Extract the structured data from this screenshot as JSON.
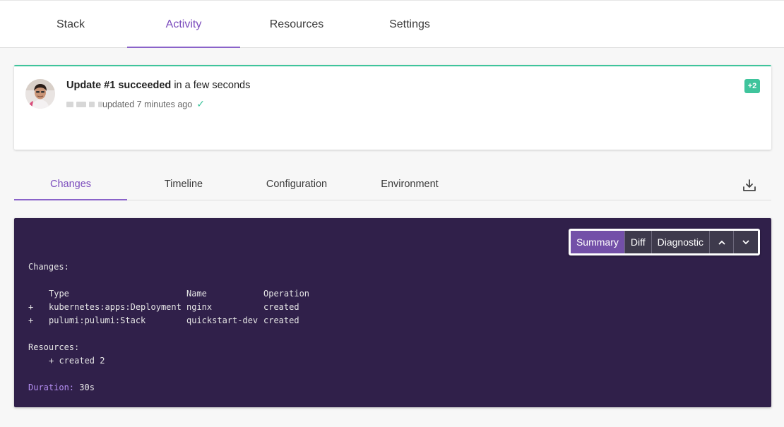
{
  "top_tabs": [
    "Stack",
    "Activity",
    "Resources",
    "Settings"
  ],
  "update": {
    "title_bold": "Update #1 succeeded",
    "title_rest": " in a few seconds",
    "sub": "updated 7 minutes ago",
    "badge": "+2"
  },
  "sub_tabs": [
    "Changes",
    "Timeline",
    "Configuration",
    "Environment"
  ],
  "toolbar": {
    "summary": "Summary",
    "diff": "Diff",
    "diagnostic": "Diagnostic",
    "up": "⌃",
    "down": "⌄"
  },
  "output": {
    "changes_label": "Changes:",
    "header": {
      "type": "Type",
      "name": "Name",
      "op": "Operation"
    },
    "rows": [
      {
        "sign": "+",
        "type": "kubernetes:apps:Deployment",
        "name": "nginx",
        "op": "created"
      },
      {
        "sign": "+",
        "type": "pulumi:pulumi:Stack",
        "name": "quickstart-dev",
        "op": "created"
      }
    ],
    "resources_label": "Resources:",
    "resources_value": "+ created 2",
    "duration_label": "Duration:",
    "duration_value": "30s"
  },
  "colors": {
    "accent": "#7c4dbd",
    "success": "#3fc49c",
    "terminal_bg": "#30204a"
  }
}
